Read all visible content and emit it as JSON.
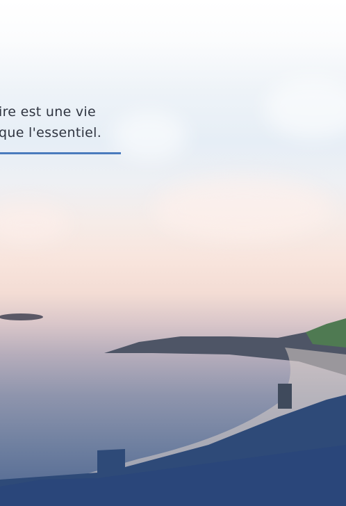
{
  "quote": {
    "line1": "ire est une vie",
    "line2": "que l'essentiel."
  },
  "colors": {
    "accent": "#4a7bbd",
    "text": "#2f3440"
  }
}
